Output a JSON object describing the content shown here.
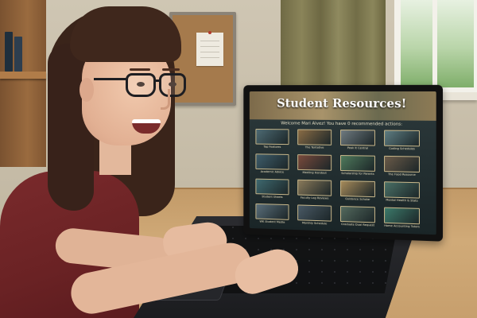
{
  "screen_ui": {
    "banner_title": "Student Resources!",
    "welcome_message": "Welcome Mari Alvez! You have 0 recommended actions:",
    "tiles": [
      {
        "label": "Tap Features",
        "color": "#4d6a73"
      },
      {
        "label": "The Tentative",
        "color": "#8a6c45"
      },
      {
        "label": "Peak It Central",
        "color": "#6f7a80"
      },
      {
        "label": "Coding Schedules",
        "color": "#5e7d82"
      },
      {
        "label": "Academic Advice",
        "color": "#3e5d6b"
      },
      {
        "label": "Meeting Handout",
        "color": "#7a4a3c"
      },
      {
        "label": "Scholarship for Parents",
        "color": "#4f7a5c"
      },
      {
        "label": "The Food Resource",
        "color": "#6a5a48"
      },
      {
        "label": "Student Sheets",
        "color": "#3f6a70"
      },
      {
        "label": "Faculty Log Reviews",
        "color": "#8a7a5a"
      },
      {
        "label": "Guidance Scholar",
        "color": "#a68a5a"
      },
      {
        "label": "Mental Health & Stats",
        "color": "#4a7066"
      },
      {
        "label": "WK Student Media",
        "color": "#5a6e7a"
      },
      {
        "label": "Monthly Schedule",
        "color": "#4a5a66"
      },
      {
        "label": "Graduate Dual Request",
        "color": "#546a5e"
      },
      {
        "label": "Home Accounting Tutors",
        "color": "#3c7a6a"
      }
    ]
  }
}
